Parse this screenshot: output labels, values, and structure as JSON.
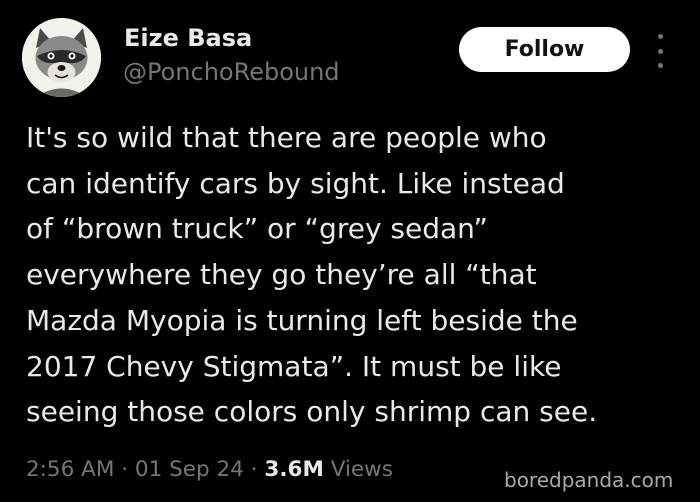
{
  "author": {
    "name": "Eize Basa",
    "handle": "@PonchoRebound",
    "avatar_icon": "raccoon-avatar"
  },
  "actions": {
    "follow_label": "Follow",
    "more_icon": "more-vertical-icon"
  },
  "tweet": {
    "lines": [
      "It's so wild that there are people who",
      "can identify cars by sight. Like instead",
      "of “brown truck” or “grey sedan”",
      "everywhere they go they’re all “that",
      "Mazda Myopia is turning left beside the",
      "2017 Chevy Stigmata”. It must be like",
      "seeing those colors only shrimp can see."
    ]
  },
  "meta": {
    "time": "2:56 AM",
    "separator": "·",
    "date": "01 Sep 24",
    "views_count": "3.6M",
    "views_label": "Views"
  },
  "watermark": "boredpanda.com",
  "colors": {
    "background": "#000000",
    "text": "#e7e9ea",
    "muted": "#71767b",
    "follow_bg": "#ffffff"
  }
}
